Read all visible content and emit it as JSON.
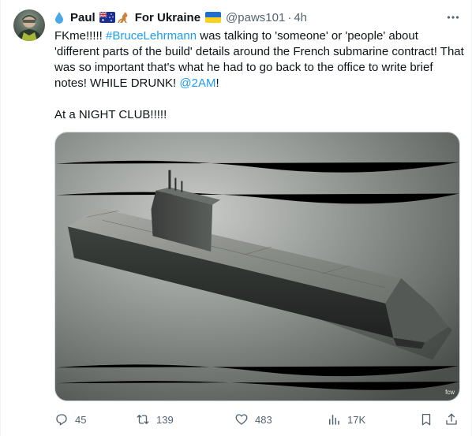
{
  "tweet": {
    "name_parts": [
      "Paul",
      "For Ukraine"
    ],
    "handle": "@paws101",
    "separator": "·",
    "time": "4h",
    "text_1_before": "FKme!!!!! ",
    "hashtag": "#BruceLehrmann",
    "text_1_after": " was talking to 'someone' or 'people' about 'different parts of the build' details around the French submarine contract! That was so important that's what he had to go back to the office to write brief notes! WHILE DRUNK! ",
    "mention": "@2AM",
    "text_1_end": "!",
    "text_2": "At a NIGHT CLUB!!!!!",
    "image_watermark": "fcw",
    "icons": {
      "drop": "water-drop-icon",
      "flag_au": "australia-flag-icon",
      "kangaroo": "kangaroo-icon",
      "flag_ua": "ukraine-flag-icon",
      "more": "more-options-icon"
    }
  },
  "actions": {
    "replies": "45",
    "retweets": "139",
    "likes": "483",
    "views": "17K"
  },
  "colors": {
    "link": "#1d9bf0",
    "muted": "#536471",
    "text": "#0f1419"
  }
}
